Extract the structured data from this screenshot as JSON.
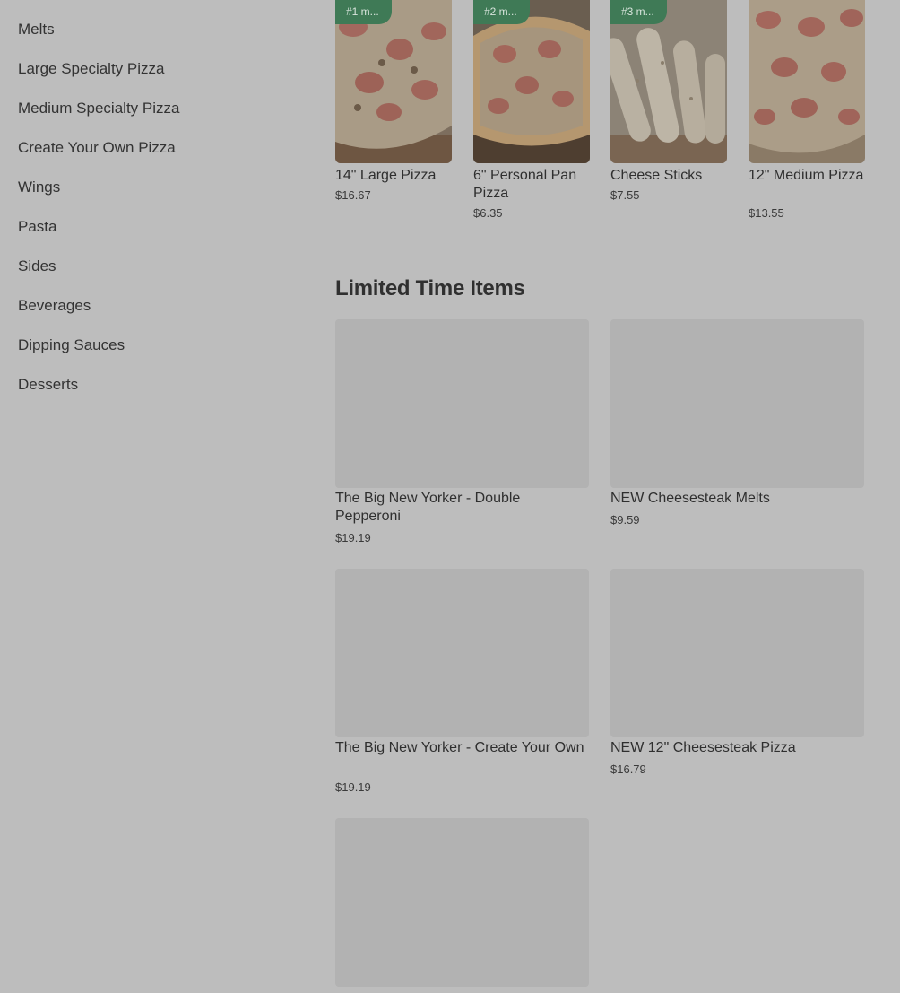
{
  "sidebar": {
    "items": [
      {
        "label": "Melts"
      },
      {
        "label": "Large Specialty Pizza"
      },
      {
        "label": "Medium Specialty Pizza"
      },
      {
        "label": "Create Your Own Pizza"
      },
      {
        "label": "Wings"
      },
      {
        "label": "Pasta"
      },
      {
        "label": "Sides"
      },
      {
        "label": "Beverages"
      },
      {
        "label": "Dipping Sauces"
      },
      {
        "label": "Desserts"
      }
    ]
  },
  "popular": {
    "items": [
      {
        "badge": "#1 m...",
        "name": "14\" Large Pizza",
        "price": "$16.67"
      },
      {
        "badge": "#2 m...",
        "name": "6\" Personal Pan Pizza",
        "price": "$6.35"
      },
      {
        "badge": "#3 m...",
        "name": "Cheese Sticks",
        "price": "$7.55"
      },
      {
        "badge": "",
        "name": "12\" Medium Pizza",
        "price": "$13.55"
      }
    ]
  },
  "limited": {
    "title": "Limited Time Items",
    "items": [
      {
        "name": "The Big New Yorker - Double Pepperoni",
        "price": "$19.19"
      },
      {
        "name": "NEW Cheesesteak Melts",
        "price": "$9.59"
      },
      {
        "name": "The Big New Yorker - Create Your Own",
        "price": "$19.19"
      },
      {
        "name": "NEW 12\" Cheesesteak Pizza",
        "price": "$16.79"
      },
      {
        "name": "",
        "price": ""
      }
    ]
  },
  "colors": {
    "overlay_background": "#bdbdbd",
    "badge_green": "#3f7a56",
    "placeholder_gray": "#b2b2b2"
  }
}
